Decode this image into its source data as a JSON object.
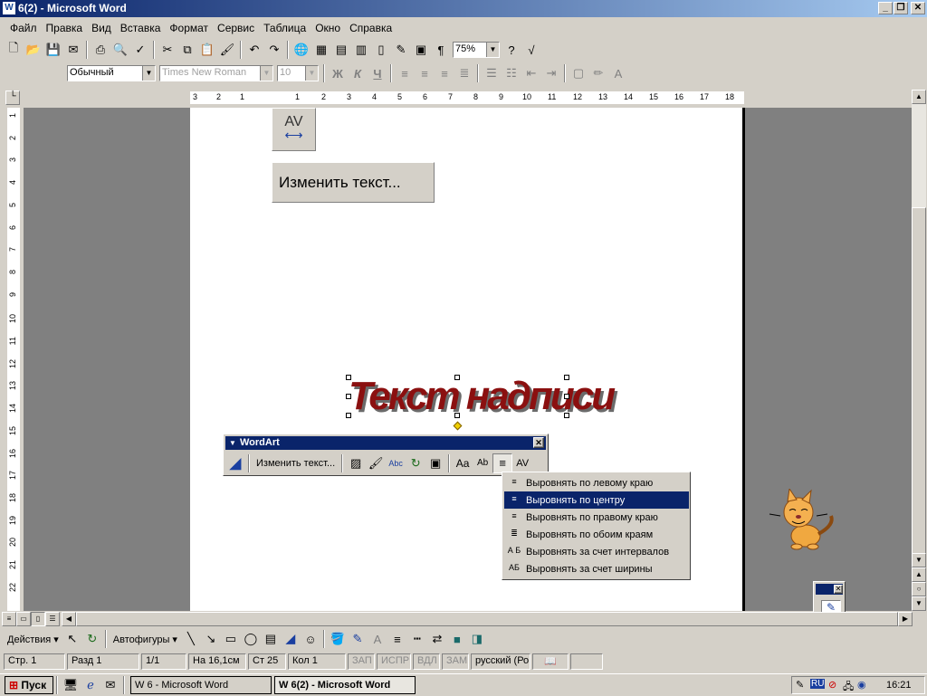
{
  "window": {
    "title": "6(2) - Microsoft Word"
  },
  "menu": [
    "Файл",
    "Правка",
    "Вид",
    "Вставка",
    "Формат",
    "Сервис",
    "Таблица",
    "Окно",
    "Справка"
  ],
  "standard_toolbar": {
    "zoom": "75%"
  },
  "format_toolbar": {
    "style": "Обычный",
    "font": "Times New Roman",
    "size": "10",
    "bold": "Ж",
    "italic": "К",
    "underline": "Ч"
  },
  "ruler": {
    "h_numbers": [
      "3",
      "2",
      "1",
      "1",
      "2",
      "3",
      "4",
      "5",
      "6",
      "7",
      "8",
      "9",
      "10",
      "11",
      "12",
      "13",
      "14",
      "15",
      "16",
      "17",
      "18"
    ],
    "v_numbers": [
      "1",
      "2",
      "3",
      "4",
      "5",
      "6",
      "7",
      "8",
      "9",
      "10",
      "11",
      "12",
      "13",
      "14",
      "15",
      "16",
      "17",
      "18",
      "19",
      "20",
      "21",
      "22"
    ]
  },
  "preview": {
    "spacing_icon": "AV",
    "edit_text_button": "Изменить текст..."
  },
  "wordart": {
    "text": "Текст надписи",
    "color": "#8b1010"
  },
  "wordart_toolbar": {
    "title": "WordArt",
    "edit_text": "Изменить текст...",
    "btn_aa": "Aa",
    "btn_ab": "Аb",
    "btn_av": "AV"
  },
  "align_menu": {
    "items": [
      {
        "label": "Выровнять по левому краю",
        "icon": "align-left-icon"
      },
      {
        "label": "Выровнять по центру",
        "icon": "align-center-icon",
        "selected": true
      },
      {
        "label": "Выровнять по правому краю",
        "icon": "align-right-icon"
      },
      {
        "label": "Выровнять по обоим краям",
        "icon": "align-justify-icon"
      },
      {
        "label": "Выровнять за счет интервалов",
        "icon": "letter-justify-icon",
        "icon_text": "А Б"
      },
      {
        "label": "Выровнять за счет ширины",
        "icon": "stretch-justify-icon",
        "icon_text": "АБ"
      }
    ]
  },
  "drawing_toolbar": {
    "actions": "Действия",
    "autoshapes": "Автофигуры"
  },
  "status": {
    "page": "Стр. 1",
    "section": "Разд 1",
    "pages": "1/1",
    "at": "На 16,1см",
    "line": "Ст 25",
    "col": "Кол 1",
    "rec": "ЗАП",
    "trk": "ИСПР",
    "ext": "ВДЛ",
    "ovr": "ЗАМ",
    "lang": "русский (Ро"
  },
  "taskbar": {
    "start": "Пуск",
    "task1": "6 - Microsoft Word",
    "task2": "6(2) - Microsoft Word",
    "lang": "RU",
    "clock": "16:21"
  }
}
